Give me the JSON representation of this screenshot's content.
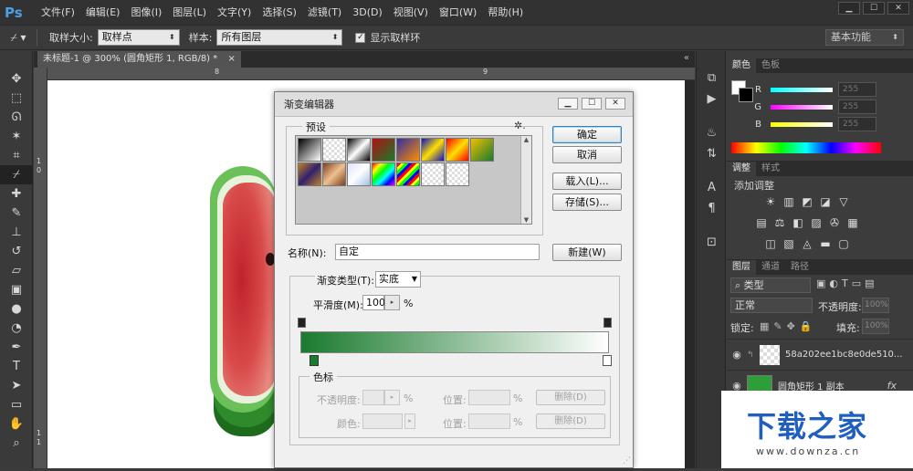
{
  "app": {
    "logo": "Ps"
  },
  "menu": [
    "文件(F)",
    "编辑(E)",
    "图像(I)",
    "图层(L)",
    "文字(Y)",
    "选择(S)",
    "滤镜(T)",
    "3D(D)",
    "视图(V)",
    "窗口(W)",
    "帮助(H)"
  ],
  "window_controls": [
    "▁",
    "☐",
    "✕"
  ],
  "options": {
    "sample_size_label": "取样大小:",
    "sample_size_value": "取样点",
    "sample_label": "样本:",
    "sample_value": "所有图层",
    "show_ring_label": "显示取样环",
    "workspace": "基本功能"
  },
  "document": {
    "tab_title": "未标题-1 @ 300% (圆角矩形 1, RGB/8) *",
    "tab_close": "×",
    "ruler_h": [
      "8",
      "9"
    ],
    "ruler_v": [
      "1",
      "0",
      "1",
      "1"
    ]
  },
  "tools": [
    "move-icon",
    "marquee-icon",
    "lasso-icon",
    "magic-wand-icon",
    "crop-icon",
    "eyedropper-icon",
    "healing-icon",
    "brush-icon",
    "stamp-icon",
    "history-brush-icon",
    "eraser-icon",
    "gradient-icon",
    "blur-icon",
    "dodge-icon",
    "pen-icon",
    "type-icon",
    "path-select-icon",
    "shape-icon",
    "hand-icon",
    "zoom-icon"
  ],
  "color_panel": {
    "tabs": [
      "颜色",
      "色板"
    ],
    "rows": [
      {
        "label": "R",
        "value": "255"
      },
      {
        "label": "G",
        "value": "255"
      },
      {
        "label": "B",
        "value": "255"
      }
    ]
  },
  "adjust_panel": {
    "tabs": [
      "调整",
      "样式"
    ],
    "title": "添加调整"
  },
  "layers_panel": {
    "tabs": [
      "图层",
      "通道",
      "路径"
    ],
    "kind_label": "类型",
    "blend_mode": "正常",
    "opacity_label": "不透明度:",
    "opacity_value": "100%",
    "lock_label": "锁定:",
    "fill_label": "填充:",
    "fill_value": "100%",
    "layers": [
      {
        "name": "58a202ee1bc8e0de510..."
      },
      {
        "name": "圆角矩形 1 副本",
        "fx": "fx"
      }
    ]
  },
  "dialog": {
    "title": "渐变编辑器",
    "presets_label": "预设",
    "ok": "确定",
    "cancel": "取消",
    "load": "载入(L)...",
    "save": "存储(S)...",
    "name_label": "名称(N):",
    "name_value": "自定",
    "new_button": "新建(W)",
    "gradient_type_label": "渐变类型(T):",
    "gradient_type_value": "实底",
    "smoothness_label": "平滑度(M):",
    "smoothness_value": "100",
    "smoothness_unit": "%",
    "stops_label": "色标",
    "opacity_label": "不透明度:",
    "color_label": "颜色:",
    "position_label": "位置:",
    "percent": "%",
    "delete_label": "删除(D)",
    "gradient_colors": {
      "start": "#1a7a2e",
      "end": "#ffffff"
    }
  },
  "watermark": {
    "text": "下载之家",
    "url": "www.downza.cn"
  }
}
